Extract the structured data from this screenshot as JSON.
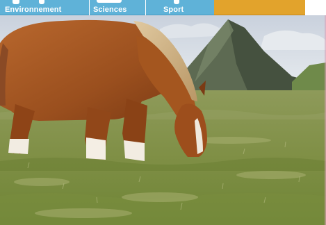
{
  "nav": {
    "items": [
      {
        "label": "Environnement",
        "icon": "environment-icon"
      },
      {
        "label": "Sciences",
        "icon": "sciences-icon"
      },
      {
        "label": "Sport",
        "icon": "sport-icon"
      }
    ]
  },
  "colors": {
    "nav_background": "#5fb2d8",
    "accent_tab": "#e2a32c",
    "nav_text": "#ffffff"
  }
}
